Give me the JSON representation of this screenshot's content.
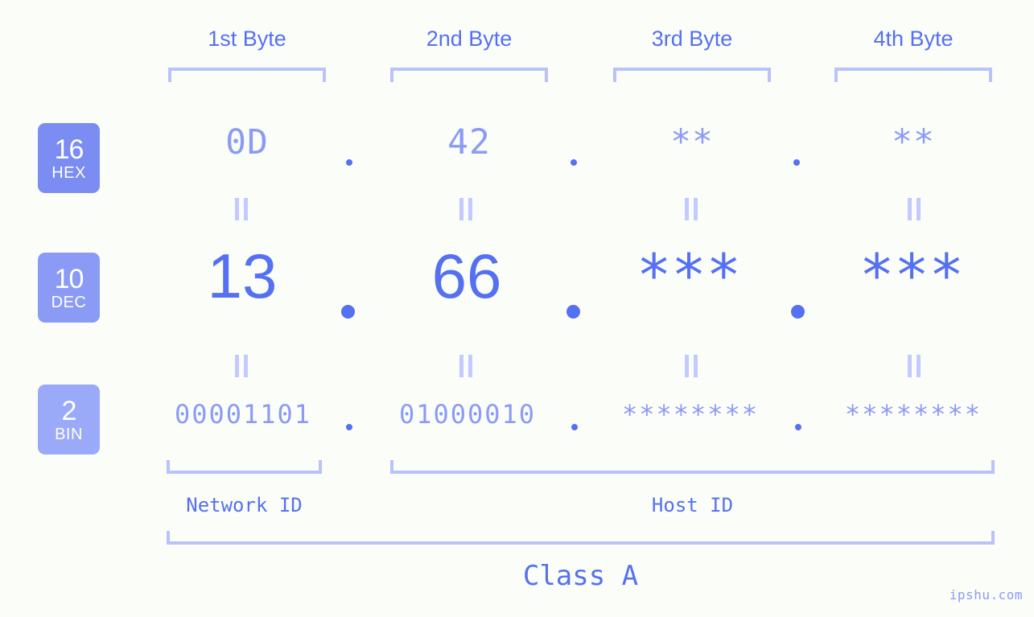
{
  "watermark": "ipshu.com",
  "colors": {
    "background": "#fbfdf8",
    "accent": "#5570f1",
    "accent_light": "#8b9bf5",
    "bracket": "#b9c2fb",
    "equals": "#c2caff",
    "badge_hex": "#7b8cf2",
    "badge_dec": "#8b9bf5",
    "badge_bin": "#9aaaf8"
  },
  "byte_headers": [
    {
      "label": "1st Byte"
    },
    {
      "label": "2nd Byte"
    },
    {
      "label": "3rd Byte"
    },
    {
      "label": "4th Byte"
    }
  ],
  "radix_badges": [
    {
      "num": "16",
      "name": "HEX"
    },
    {
      "num": "10",
      "name": "DEC"
    },
    {
      "num": "2",
      "name": "BIN"
    }
  ],
  "rows": {
    "hex": {
      "values": [
        "0D",
        "42",
        "**",
        "**"
      ]
    },
    "dec": {
      "values": [
        "13",
        "66",
        "***",
        "***"
      ]
    },
    "bin": {
      "values": [
        "00001101",
        "01000010",
        "********",
        "********"
      ]
    }
  },
  "separators": {
    "hex": [
      ".",
      ".",
      "."
    ],
    "dec": [
      ".",
      ".",
      "."
    ],
    "bin": [
      ".",
      ".",
      "."
    ]
  },
  "equals_symbol": "=",
  "id_sections": [
    {
      "label": "Network ID"
    },
    {
      "label": "Host ID"
    }
  ],
  "class_label": "Class A"
}
